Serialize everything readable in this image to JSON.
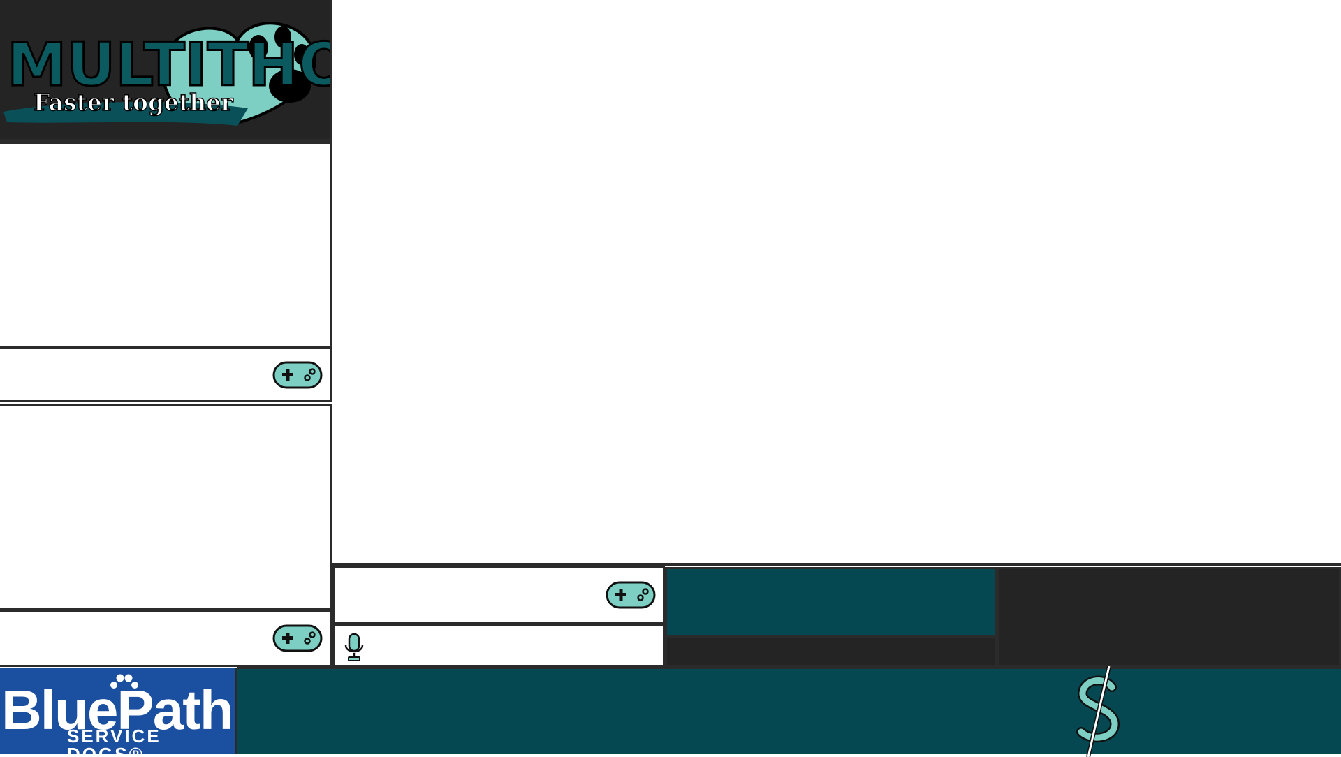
{
  "branding": {
    "event_title": "MULTITHON",
    "event_tagline": "Faster together",
    "sponsor_name": "BluePath",
    "sponsor_subtitle": "SERVICE DOGS®"
  },
  "icons": {
    "controller": "gamepad-icon",
    "microphone": "microphone-icon",
    "donation": "dollar-sign-icon",
    "logo_art": "heart-paw-icon",
    "sponsor_art": "paw-print-icon"
  },
  "colors": {
    "frame_border": "#2b2b2b",
    "dark_panel": "#242424",
    "teal_panel": "#054852",
    "accent_mint": "#7ecfc3",
    "sponsor_blue": "#1b4fa0"
  }
}
